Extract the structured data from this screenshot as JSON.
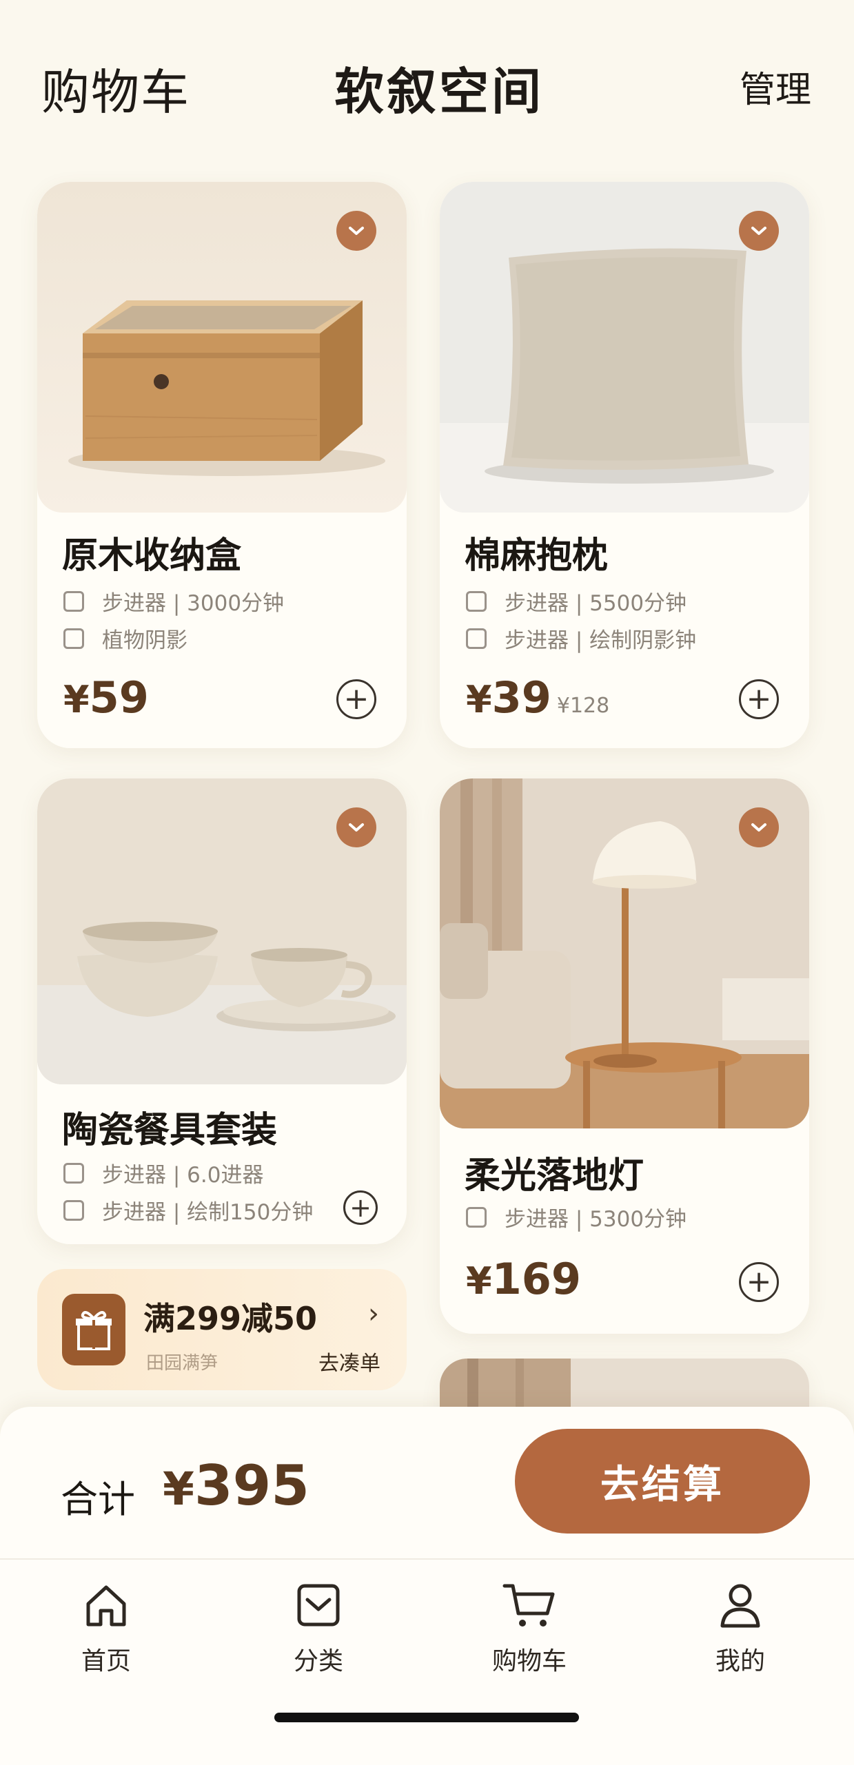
{
  "header": {
    "left": "购物车",
    "title": "软叙空间",
    "right": "管理"
  },
  "products": [
    {
      "name": "原木收纳盒",
      "options": [
        "步进器 | 3000分钟",
        "植物阴影"
      ],
      "price": "59",
      "old_price": ""
    },
    {
      "name": "棉麻抱枕",
      "options": [
        "步进器 | 5500分钟",
        "步进器 | 绘制阴影钟"
      ],
      "price": "39",
      "old_price": "¥128"
    },
    {
      "name": "陶瓷餐具套装",
      "options": [
        "步进器 | 6.0进器",
        "步进器 | 绘制150分钟"
      ],
      "price": "",
      "old_price": ""
    },
    {
      "name": "柔光落地灯",
      "options": [
        "步进器 | 5300分钟"
      ],
      "price": "169",
      "old_price": ""
    }
  ],
  "currency": "¥",
  "promo": {
    "title": "满299减50",
    "subtitle": "田园满笋",
    "action": "去凑单"
  },
  "summary": {
    "label": "合计",
    "total": "395",
    "checkout": "去结算"
  },
  "tabs": [
    {
      "label": "首页",
      "icon": "home-icon"
    },
    {
      "label": "分类",
      "icon": "category-icon"
    },
    {
      "label": "购物车",
      "icon": "cart-icon"
    },
    {
      "label": "我的",
      "icon": "profile-icon"
    }
  ],
  "colors": {
    "accent": "#b4683f",
    "price": "#5a3a20",
    "background": "#fbf8ee"
  }
}
